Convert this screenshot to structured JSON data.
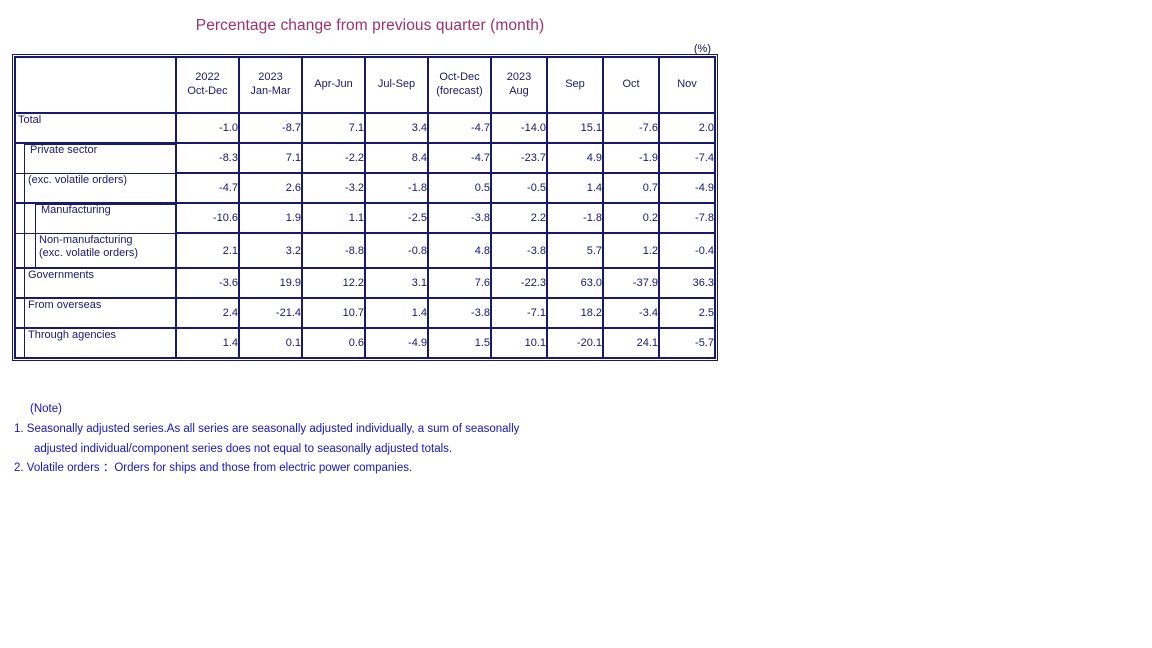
{
  "title": "Percentage change from previous quarter (month)",
  "unit_label": "(%)",
  "colors": {
    "title": "#9e3070",
    "text": "#191970",
    "value": "#0a7a2f",
    "note": "#1414c8",
    "border": "#191970"
  },
  "table": {
    "header": {
      "corner": "",
      "columns": [
        {
          "year": "2022",
          "period": "Oct-Dec",
          "note": ""
        },
        {
          "year": "2023",
          "period": "Jan-Mar",
          "note": ""
        },
        {
          "year": "",
          "period": "Apr-Jun",
          "note": ""
        },
        {
          "year": "",
          "period": "Jul-Sep",
          "note": ""
        },
        {
          "year": "",
          "period": "Oct-Dec",
          "note": "(forecast)"
        },
        {
          "year": "2023",
          "period": "Aug",
          "note": ""
        },
        {
          "year": "",
          "period": "Sep",
          "note": ""
        },
        {
          "year": "",
          "period": "Oct",
          "note": ""
        },
        {
          "year": "",
          "period": "Nov",
          "note": ""
        }
      ]
    },
    "rows": [
      {
        "label": "Total",
        "indent": 0,
        "values": [
          "-1.0",
          "-8.7",
          "7.1",
          "3.4",
          "-4.7",
          "-14.0",
          "15.1",
          "-7.6",
          "2.0"
        ]
      },
      {
        "label": "Private sector",
        "indent": 1,
        "values": [
          "-8.3",
          "7.1",
          "-2.2",
          "8.4",
          "-4.7",
          "-23.7",
          "4.9",
          "-1.9",
          "-7.4"
        ]
      },
      {
        "label": "(exc. volatile orders)",
        "indent": 1,
        "values": [
          "-4.7",
          "2.6",
          "-3.2",
          "-1.8",
          "0.5",
          "-0.5",
          "1.4",
          "0.7",
          "-4.9"
        ]
      },
      {
        "label": "Manufacturing",
        "indent": 2,
        "values": [
          "-10.6",
          "1.9",
          "1.1",
          "-2.5",
          "-3.8",
          "2.2",
          "-1.8",
          "0.2",
          "-7.8"
        ]
      },
      {
        "label_line1": "Non-manufacturing",
        "label_line2": "(exc. volatile orders)",
        "indent": 2,
        "values": [
          "2.1",
          "3.2",
          "-8.8",
          "-0.8",
          "4.8",
          "-3.8",
          "5.7",
          "1.2",
          "-0.4"
        ]
      },
      {
        "label": "Governments",
        "indent": 1,
        "values": [
          "-3.6",
          "19.9",
          "12.2",
          "3.1",
          "7.6",
          "-22.3",
          "63.0",
          "-37.9",
          "36.3"
        ]
      },
      {
        "label": "From overseas",
        "indent": 1,
        "values": [
          "2.4",
          "-21.4",
          "10.7",
          "1.4",
          "-3.8",
          "-7.1",
          "18.2",
          "-3.4",
          "2.5"
        ]
      },
      {
        "label": "Through agencies",
        "indent": 1,
        "values": [
          "1.4",
          "0.1",
          "0.6",
          "-4.9",
          "1.5",
          "10.1",
          "-20.1",
          "24.1",
          "-5.7"
        ]
      }
    ]
  },
  "notes": {
    "heading": "(Note)",
    "line1": "1. Seasonally adjusted series.As all series are seasonally adjusted individually,  a sum of seasonally",
    "line1_cont": "adjusted individual/component series does not equal to seasonally adjusted totals.",
    "line2": "2. Volatile orders ：Orders for ships and those from electric power companies."
  }
}
